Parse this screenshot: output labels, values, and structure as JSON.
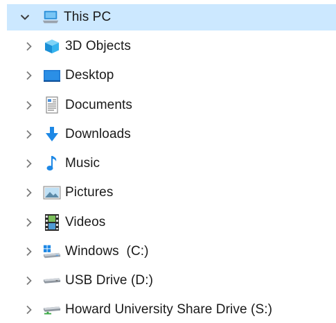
{
  "tree": {
    "root": {
      "label": "This PC",
      "icon": "computer-icon",
      "expanded": true
    },
    "items": [
      {
        "label": "3D Objects",
        "icon": "3d-objects-icon"
      },
      {
        "label": "Desktop",
        "icon": "desktop-icon"
      },
      {
        "label": "Documents",
        "icon": "documents-icon"
      },
      {
        "label": "Downloads",
        "icon": "downloads-icon"
      },
      {
        "label": "Music",
        "icon": "music-icon"
      },
      {
        "label": "Pictures",
        "icon": "pictures-icon"
      },
      {
        "label": "Videos",
        "icon": "videos-icon"
      },
      {
        "label": "Windows  (C:)",
        "icon": "windows-drive-icon"
      },
      {
        "label": "USB Drive (D:)",
        "icon": "usb-drive-icon"
      },
      {
        "label": "Howard University Share Drive (S:)",
        "icon": "network-drive-icon"
      }
    ]
  },
  "colors": {
    "selection": "#cce8ff",
    "chevron": "#5f5f5f",
    "accent": "#1e88e5"
  }
}
